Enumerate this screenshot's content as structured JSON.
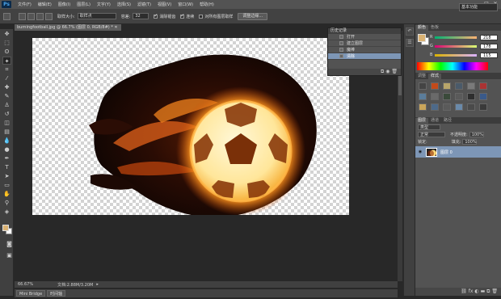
{
  "app": {
    "logo": "Ps"
  },
  "menu": [
    "文件(F)",
    "编辑(E)",
    "图像(I)",
    "图层(L)",
    "文字(Y)",
    "选择(S)",
    "滤镜(T)",
    "视图(V)",
    "窗口(W)",
    "帮助(H)"
  ],
  "window_controls": [
    "—",
    "□",
    "✕"
  ],
  "options": {
    "sample_size_label": "取样大小:",
    "sample_size_value": "取样点",
    "tolerance_label": "容差:",
    "tolerance_value": "32",
    "antialias_label": "消除锯齿",
    "contiguous_label": "连续",
    "all_layers_label": "对所有图层取样",
    "refine_edge_label": "调整边缘...",
    "workspace": "基本功能"
  },
  "document": {
    "tab_title": "burningfootball.jpg @ 66.7% (图层 0, RGB/8#) * ✕",
    "zoom": "66.67%",
    "doc_info": "文档:2.88M/3.20M"
  },
  "mini_bridge": {
    "tabs": [
      "Mini Bridge",
      "时间轴"
    ]
  },
  "history": {
    "title": "历史记录",
    "items": [
      "打开",
      "建立图层",
      "魔棒",
      "清除"
    ],
    "selected_index": 3
  },
  "color_panel": {
    "tabs": [
      "颜色",
      "色板"
    ],
    "r_label": "R",
    "r_value": "218",
    "g_label": "G",
    "g_value": "178",
    "b_label": "B",
    "b_value": "115",
    "foreground": "#dab273",
    "background": "#ffffff"
  },
  "adjust_panel": {
    "tabs": [
      "调整",
      "样式"
    ]
  },
  "layers_panel": {
    "tabs": [
      "图层",
      "通道",
      "路径"
    ],
    "kind_label": "类型",
    "blend_mode": "正常",
    "opacity_label": "不透明度:",
    "opacity_value": "100%",
    "lock_label": "锁定:",
    "fill_label": "填充:",
    "fill_value": "100%",
    "layer_name": "图层 0"
  },
  "colors": {
    "accent": "#7d96b6",
    "fire": "#ff8a1e"
  }
}
